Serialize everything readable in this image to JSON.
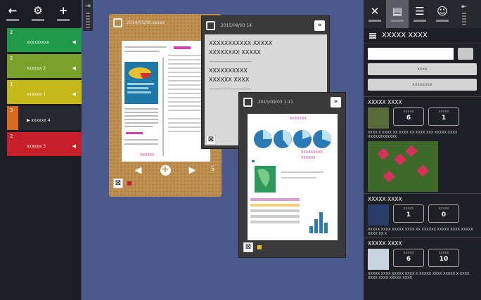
{
  "left_toolbar": {
    "buttons": [
      {
        "name": "back",
        "glyph": "←"
      },
      {
        "name": "settings",
        "glyph": "⚙"
      },
      {
        "name": "add",
        "glyph": "+"
      }
    ],
    "handle_glyph": "⇥"
  },
  "tabs": [
    {
      "num": "2",
      "label": "xxxxxxxxx",
      "color": "#1f9a4a"
    },
    {
      "num": "2",
      "label": "xxxxxx 2",
      "color": "#7aa12a"
    },
    {
      "num": "1",
      "label": "xxxxxx 1",
      "color": "#c4b81a"
    },
    {
      "num": "3",
      "label": "xxxxxx 4",
      "color": "#d86a1e",
      "selected": true
    },
    {
      "num": "2",
      "label": "xxxxxx 3",
      "color": "#c8202a"
    }
  ],
  "cork_window": {
    "title": "2014/05/06 xxxxx",
    "page_number": "5",
    "page_text": "XXXXXX"
  },
  "note_window": {
    "title": "2015/09/03 14",
    "lines": [
      "XXXXXXXXXXX XXXXX",
      "XXXXXXXX XXXXX",
      "---------------------",
      "XXXXXXXXXX",
      "XXXXXX XXXX",
      "---------------------"
    ]
  },
  "doc_window": {
    "title": "2015/09/03 1:11",
    "page_labels": [
      "XXXXXXX",
      "XXXXXXXXX",
      "XXXXXX"
    ]
  },
  "right_toolbar": {
    "buttons": [
      {
        "name": "close",
        "glyph": "✕"
      },
      {
        "name": "list-view",
        "glyph": "▤",
        "active": true
      },
      {
        "name": "menu",
        "glyph": "☰"
      },
      {
        "name": "user",
        "glyph": "☺"
      }
    ],
    "handle_glyph": "⇤"
  },
  "right_panel": {
    "header": "XXXXX XXXX",
    "search_placeholder": "",
    "button1": "xxxx",
    "button2": "xxxxxxxx",
    "items": [
      {
        "title": "XXXXX XXXX",
        "stat1_label": "xxxxx",
        "stat1": "6",
        "stat2_label": "xxxxx",
        "stat2": "1",
        "thumb": "#5a6b3a",
        "desc": "XXXX X XXXX XX XXXX XX XXXX XXX XXXXX XXXX XXXXXXXXXXXX"
      },
      {
        "title": "XXXXX XXXX",
        "stat1_label": "xxxxx",
        "stat1": "1",
        "stat2_label": "xxxxx",
        "stat2": "0",
        "thumb": "#2a3c6a",
        "desc": "XXXXX XXXX XXXXX XXXX XX XXXXXX XXXXX XXXX XXXXX XXXX XX X"
      },
      {
        "title": "XXXXX XXXX",
        "stat1_label": "xxxxx",
        "stat1": "6",
        "stat2_label": "xxxxx",
        "stat2": "10",
        "thumb": "#c8d4e0",
        "desc": "XXXXX XXXX XXXXX XXXX X XXXXX XXXX XXXXX X XXXX XXXX XXXX XXXXX XXXX"
      }
    ]
  }
}
